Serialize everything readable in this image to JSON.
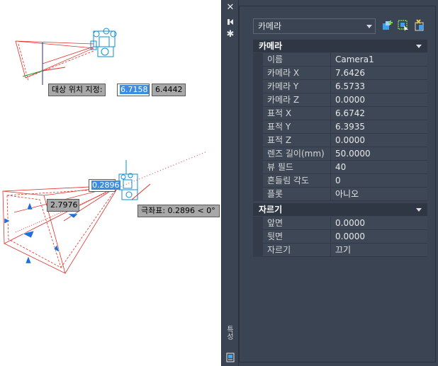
{
  "canvas": {
    "prompt_label": "대상 위치 지정:",
    "target_x_value": "6.7158",
    "target_y_value": "6.4442",
    "dist_value": "0.2896",
    "length_value": "2.7976",
    "polar_label": "극좌표: 0.2896 < 0°"
  },
  "palette": {
    "strip_title": "특성",
    "object_type": "카메라",
    "sections": [
      {
        "title": "카메라",
        "rows": [
          {
            "name": "이름",
            "value": "Camera1"
          },
          {
            "name": "카메라 X",
            "value": "7.6426"
          },
          {
            "name": "카메라 Y",
            "value": "6.5733"
          },
          {
            "name": "카메라 Z",
            "value": "0.0000"
          },
          {
            "name": "표적 X",
            "value": "6.6742"
          },
          {
            "name": "표적 Y",
            "value": "6.3935"
          },
          {
            "name": "표적 Z",
            "value": "0.0000"
          },
          {
            "name": "렌즈 길이(mm)",
            "value": "50.0000"
          },
          {
            "name": "뷰 필드",
            "value": "40"
          },
          {
            "name": "흔들림 각도",
            "value": "0"
          },
          {
            "name": "플롯",
            "value": "아니오"
          }
        ]
      },
      {
        "title": "자르기",
        "rows": [
          {
            "name": "앞면",
            "value": "0.0000"
          },
          {
            "name": "뒷면",
            "value": "0.0000"
          },
          {
            "name": "자르기",
            "value": "끄기"
          }
        ]
      }
    ]
  },
  "colors": {
    "palette_bg": "#3b4453",
    "glyph_cyan": "#0a8fd6",
    "frustum_red": "#e0302a",
    "grip_blue": "#1f6fd8",
    "selection_blue": "#3c8de0"
  },
  "icons": [
    "close-icon",
    "pin-icon",
    "settings-icon",
    "quick-select-icon",
    "select-objects-icon",
    "toggle-pickadd-icon",
    "properties-icon"
  ]
}
